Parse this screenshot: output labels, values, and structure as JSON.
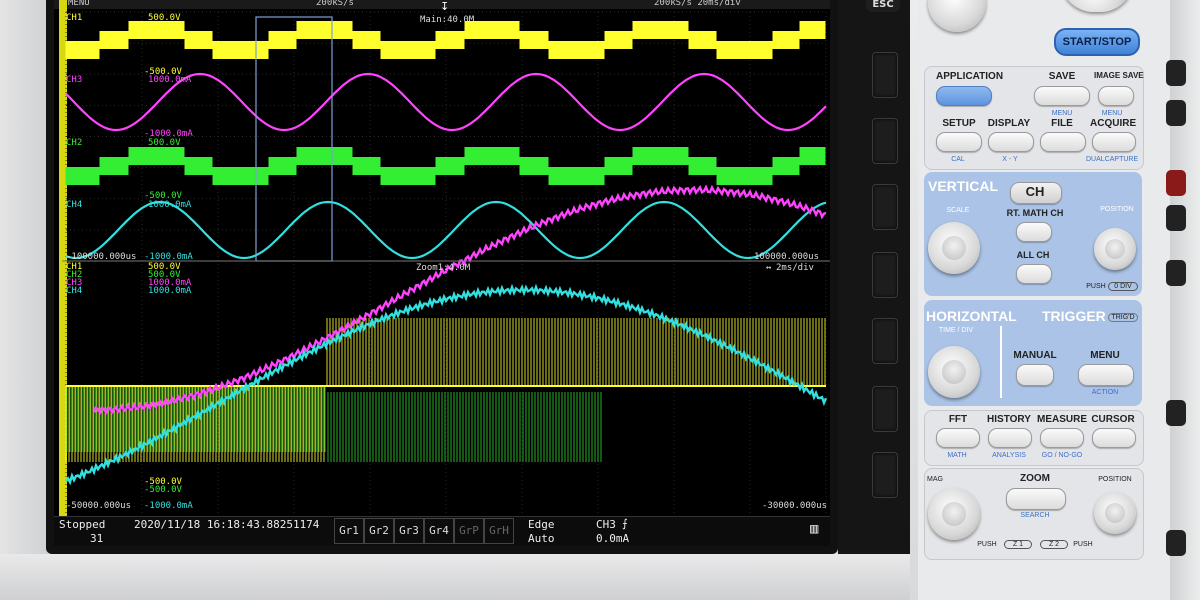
{
  "screen": {
    "topbar": {
      "menu_label": "MENU",
      "main_zoom_label": "Main:40.0M",
      "acq_text": "200kS/s",
      "right_text": "200kS/s   20ms/div"
    },
    "main_window": {
      "channels": [
        {
          "name": "CH1",
          "upper": "500.0V",
          "lower": "-500.0V",
          "color": "#ffff2e"
        },
        {
          "name": "CH3",
          "upper": "1000.0mA",
          "lower": "-1000.0mA",
          "color": "#ff44ff"
        },
        {
          "name": "CH2",
          "upper": "500.0V",
          "lower": "-500.0V",
          "color": "#33ee33"
        },
        {
          "name": "CH4",
          "upper": "1000.0mA",
          "lower": "-1000.0mA",
          "color": "#33e0e0"
        }
      ],
      "time_left": "-100000.000us",
      "time_right": "100000.000us",
      "zoom_label": "Zoom1:4.0M"
    },
    "zoom_window": {
      "timebase": "2ms/div",
      "legend": [
        {
          "name": "CH1",
          "value": "500.0V",
          "color": "#ffff2e"
        },
        {
          "name": "CH2",
          "value": "500.0V",
          "color": "#33ee33"
        },
        {
          "name": "CH3",
          "value": "1000.0mA",
          "color": "#ff44ff"
        },
        {
          "name": "CH4",
          "value": "1000.0mA",
          "color": "#33e0e0"
        }
      ],
      "lower_labels": [
        {
          "value": "-500.0V",
          "color": "#ffff2e"
        },
        {
          "value": "-500.0V",
          "color": "#33ee33"
        },
        {
          "value": "-1000.0mA",
          "color": "#33e0e0"
        }
      ],
      "time_left": "-50000.000us",
      "time_right": "-30000.000us"
    },
    "status": {
      "state": "Stopped",
      "count": "31",
      "datetime": "2020/11/18  16:18:43.88251174",
      "groups": [
        "Gr1",
        "Gr2",
        "Gr3",
        "Gr4",
        "GrP",
        "GrH"
      ],
      "trigger_type": "Edge",
      "trigger_mode": "Auto",
      "trigger_source": "CH3",
      "trigger_level": "0.0mA"
    }
  },
  "side": {
    "esc_label": "ESC"
  },
  "panel": {
    "start_stop": "START/STOP",
    "application": "APPLICATION",
    "save": "SAVE",
    "image_save": "IMAGE SAVE",
    "menu_small": "MENU",
    "setup": "SETUP",
    "display": "DISPLAY",
    "file": "FILE",
    "acquire": "ACQUIRE",
    "cal": "CAL",
    "x_y": "X - Y",
    "dualcapture": "DUALCAPTURE",
    "vertical": "VERTICAL",
    "ch": "CH",
    "scale": "SCALE",
    "rt_math_ch": "RT. MATH CH",
    "position": "POSITION",
    "all_ch": "ALL CH",
    "push_0div": "PUSH",
    "zero_div": "0 DIV",
    "horizontal": "HORIZONTAL",
    "trigger": "TRIGGER",
    "trigd": "TRIG'D",
    "time_div": "TIME / DIV",
    "manual": "MANUAL",
    "menu": "MENU",
    "action": "ACTION",
    "fft": "FFT",
    "history": "HISTORY",
    "measure": "MEASURE",
    "cursor": "CURSOR",
    "math": "MATH",
    "analysis": "ANALYSIS",
    "go_nogo": "GO / NO-GO",
    "mag": "MAG",
    "zoom": "ZOOM",
    "search": "SEARCH",
    "push_left": "PUSH",
    "z1": "Z 1",
    "z2": "Z 2",
    "push_right": "PUSH"
  }
}
